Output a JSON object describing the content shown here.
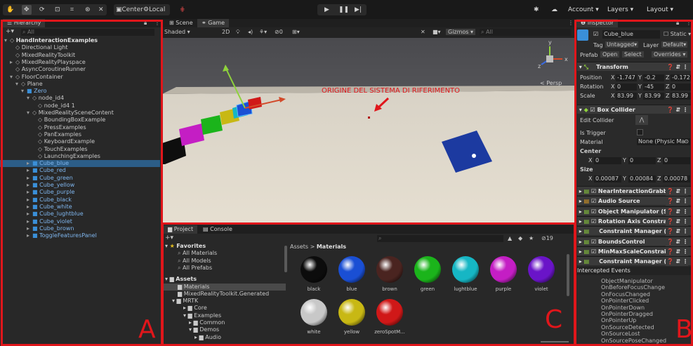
{
  "toolbar": {
    "center_label": "Center",
    "local_label": "Local",
    "account_label": "Account",
    "layers_label": "Layers",
    "layout_label": "Layout"
  },
  "hierarchy": {
    "tab_label": "Hierarchy",
    "search_placeholder": "All",
    "items": [
      "HandInteractionExamples",
      "Directional Light",
      "MixedRealityToolkit",
      "MixedRealityPlayspace",
      "AsyncCoroutineRunner",
      "FloorContainer",
      "Plane",
      "Zero",
      "node_id4",
      "node_id4 1",
      "MixedRealitySceneContent",
      "BoundingBoxExample",
      "PressExamples",
      "PanExamples",
      "KeyboardExample",
      "TouchExamples",
      "LaunchingExamples",
      "Cube_blue",
      "Cube_red",
      "Cube_green",
      "Cube_yellow",
      "Cube_purple",
      "Cube_black",
      "Cube_white",
      "Cube_lughtblue",
      "Cube_violet",
      "Cube_brown",
      "ToggleFeaturesPanel"
    ]
  },
  "scene": {
    "tab_scene": "Scene",
    "tab_game": "Game",
    "shading": "Shaded",
    "mode_2d": "2D",
    "gizmos_label": "Gizmos",
    "search_placeholder": "All",
    "persp_label": "< Persp",
    "axis_y": "y",
    "axis_x": "x",
    "axis_z": "z",
    "annotation": "ORIGINE DEL SISTEMA DI RIFERIMENTO",
    "zero_count": "0"
  },
  "project": {
    "tab_project": "Project",
    "tab_console": "Console",
    "favorites_label": "Favorites",
    "favorites": [
      "All Materials",
      "All Models",
      "All Prefabs"
    ],
    "assets_label": "Assets",
    "tree": [
      "Materials",
      "MixedRealityToolkit.Generated",
      "MRTK",
      "Core",
      "Examples",
      "Common",
      "Demos",
      "Audio"
    ],
    "breadcrumb_root": "Assets",
    "breadcrumb_sep": ">",
    "breadcrumb_leaf": "Materials",
    "count": "19",
    "materials": [
      {
        "name": "black",
        "color": "#0c0c0c"
      },
      {
        "name": "blue",
        "color": "#1a4fd4"
      },
      {
        "name": "brown",
        "color": "#4a2420"
      },
      {
        "name": "green",
        "color": "#1bb41b"
      },
      {
        "name": "lughtblue",
        "color": "#16b6c4"
      },
      {
        "name": "purple",
        "color": "#c41ec4"
      },
      {
        "name": "violet",
        "color": "#6a14c8"
      },
      {
        "name": "white",
        "color": "#c8c8c8"
      },
      {
        "name": "yellow",
        "color": "#c8b814"
      },
      {
        "name": "zeroSpotM...",
        "color": "#d01818"
      }
    ]
  },
  "inspector": {
    "tab_label": "Inspector",
    "object_name": "Cube_blue",
    "static_label": "Static",
    "tag_label": "Tag",
    "tag_value": "Untagged",
    "layer_label": "Layer",
    "layer_value": "Default",
    "prefab_label": "Prefab",
    "open_label": "Open",
    "select_label": "Select",
    "overrides_label": "Overrides",
    "transform": {
      "title": "Transform",
      "position_label": "Position",
      "rotation_label": "Rotation",
      "scale_label": "Scale",
      "x": "X",
      "y": "Y",
      "z": "Z",
      "pos_x": "-1.747",
      "pos_y": "-0.2",
      "pos_z": "-0.172",
      "rot_x": "0",
      "rot_y": "-45",
      "rot_z": "0",
      "scl_x": "83.99",
      "scl_y": "83.99",
      "scl_z": "83.99"
    },
    "box_collider": {
      "title": "Box Collider",
      "edit_collider": "Edit Collider",
      "is_trigger": "Is Trigger",
      "material": "Material",
      "material_value": "None (Physic Ma",
      "center": "Center",
      "size": "Size",
      "cx": "0",
      "cy": "0",
      "cz": "0",
      "sx": "0.00087",
      "sy": "0.00084",
      "sz": "0.00078"
    },
    "components": [
      "NearInteractionGrabbal",
      "Audio Source",
      "Object Manipulator (Sc",
      "Rotation Axis Constrain",
      "Constraint Manager (Sc",
      "BoundsControl",
      "MinMaxScaleConstrain",
      "Constraint Manager (Sc"
    ],
    "intercepted_title": "Intercepted Events",
    "events": [
      "ObjectManipulator",
      "OnBeforeFocusChange",
      "OnFocusChanged",
      "OnPointerClicked",
      "OnPointerDown",
      "OnPointerDragged",
      "OnPointerUp",
      "OnSourceDetected",
      "OnSourceLost",
      "OnSourcePoseChanged"
    ]
  },
  "labels": {
    "a": "A",
    "b": "B",
    "c": "C"
  },
  "colors": {
    "frame": "#e0161b",
    "selection": "#2c5d87",
    "cube_blue": "#1a4fd4"
  }
}
